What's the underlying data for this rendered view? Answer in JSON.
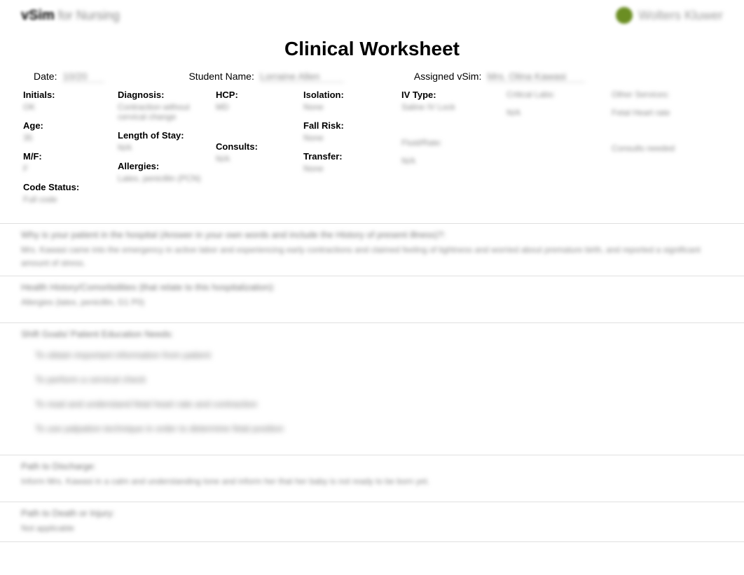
{
  "header": {
    "logo_left_bold": "vSim",
    "logo_left_light": "for Nursing",
    "logo_right_text": "Wolters Kluwer"
  },
  "title": "Clinical Worksheet",
  "top_row": {
    "date_label": "Date:",
    "date_value": "10/20",
    "student_label": "Student Name:",
    "student_value": "Lorraine Allen",
    "vsim_label": "Assigned vSim:",
    "vsim_value": "Mrs. Olina Kawasi"
  },
  "info": {
    "col1": {
      "initials_label": "Initials:",
      "initials_value": "OK",
      "age_label": "Age:",
      "age_value": "35",
      "mf_label": "M/F:",
      "mf_value": "F",
      "code_label": "Code Status:",
      "code_value": "Full code"
    },
    "col2": {
      "diagnosis_label": "Diagnosis:",
      "diagnosis_value": "Contraction without cervical change",
      "los_label": "Length of Stay:",
      "los_value": "N/A",
      "allergies_label": "Allergies:",
      "allergies_value": "Latex, penicillin (PCN)"
    },
    "col3": {
      "hcp_label": "HCP:",
      "hcp_value": "MD",
      "consults_label": "Consults:",
      "consults_value": "N/A"
    },
    "col4": {
      "isolation_label": "Isolation:",
      "isolation_value": "None",
      "fallrisk_label": "Fall Risk:",
      "fallrisk_value": "None",
      "transfer_label": "Transfer:",
      "transfer_value": "None"
    },
    "col5": {
      "ivtype_label": "IV Type:",
      "ivtype_value": "Saline IV Lock",
      "ivtype_value2": " ",
      "fluid_label": "Fluid/Rate:",
      "fluid_value": "N/A"
    },
    "col6": {
      "crit_label": "Critical Labs:",
      "crit_value": "N/A"
    },
    "col7": {
      "other_label": "Other Services:",
      "other_value": "Fetal Heart rate",
      "consults2_label": " ",
      "consults2_value": "Consults needed"
    }
  },
  "sections": {
    "s1": {
      "title": "Why is your patient in the hospital (Answer in your own words and include the History of present illness)?:",
      "body": "Mrs. Kawasi came into the emergency in active labor and experiencing early contractions and claimed feeling of tightness and worried about premature birth, and reported a significant amount of stress."
    },
    "s2": {
      "title": "Health History/Comorbidities (that relate to this hospitalization):",
      "body": "Allergies (latex, penicillin, G1 P0)"
    },
    "s3": {
      "title": "Shift Goals/ Patient Education Needs:"
    },
    "goals": [
      "To obtain important information from patient",
      "To perform a cervical check",
      "To read and understand fetal heart rate and contraction",
      "To use palpation technique in order to determine fetal position"
    ],
    "s4": {
      "title": "Path to Discharge:",
      "body": "Inform Mrs. Kawasi in a calm and understanding tone and inform her that her baby is not ready to be born yet."
    },
    "s5": {
      "title": "Path to Death or Injury:",
      "body": "Not applicable"
    }
  }
}
